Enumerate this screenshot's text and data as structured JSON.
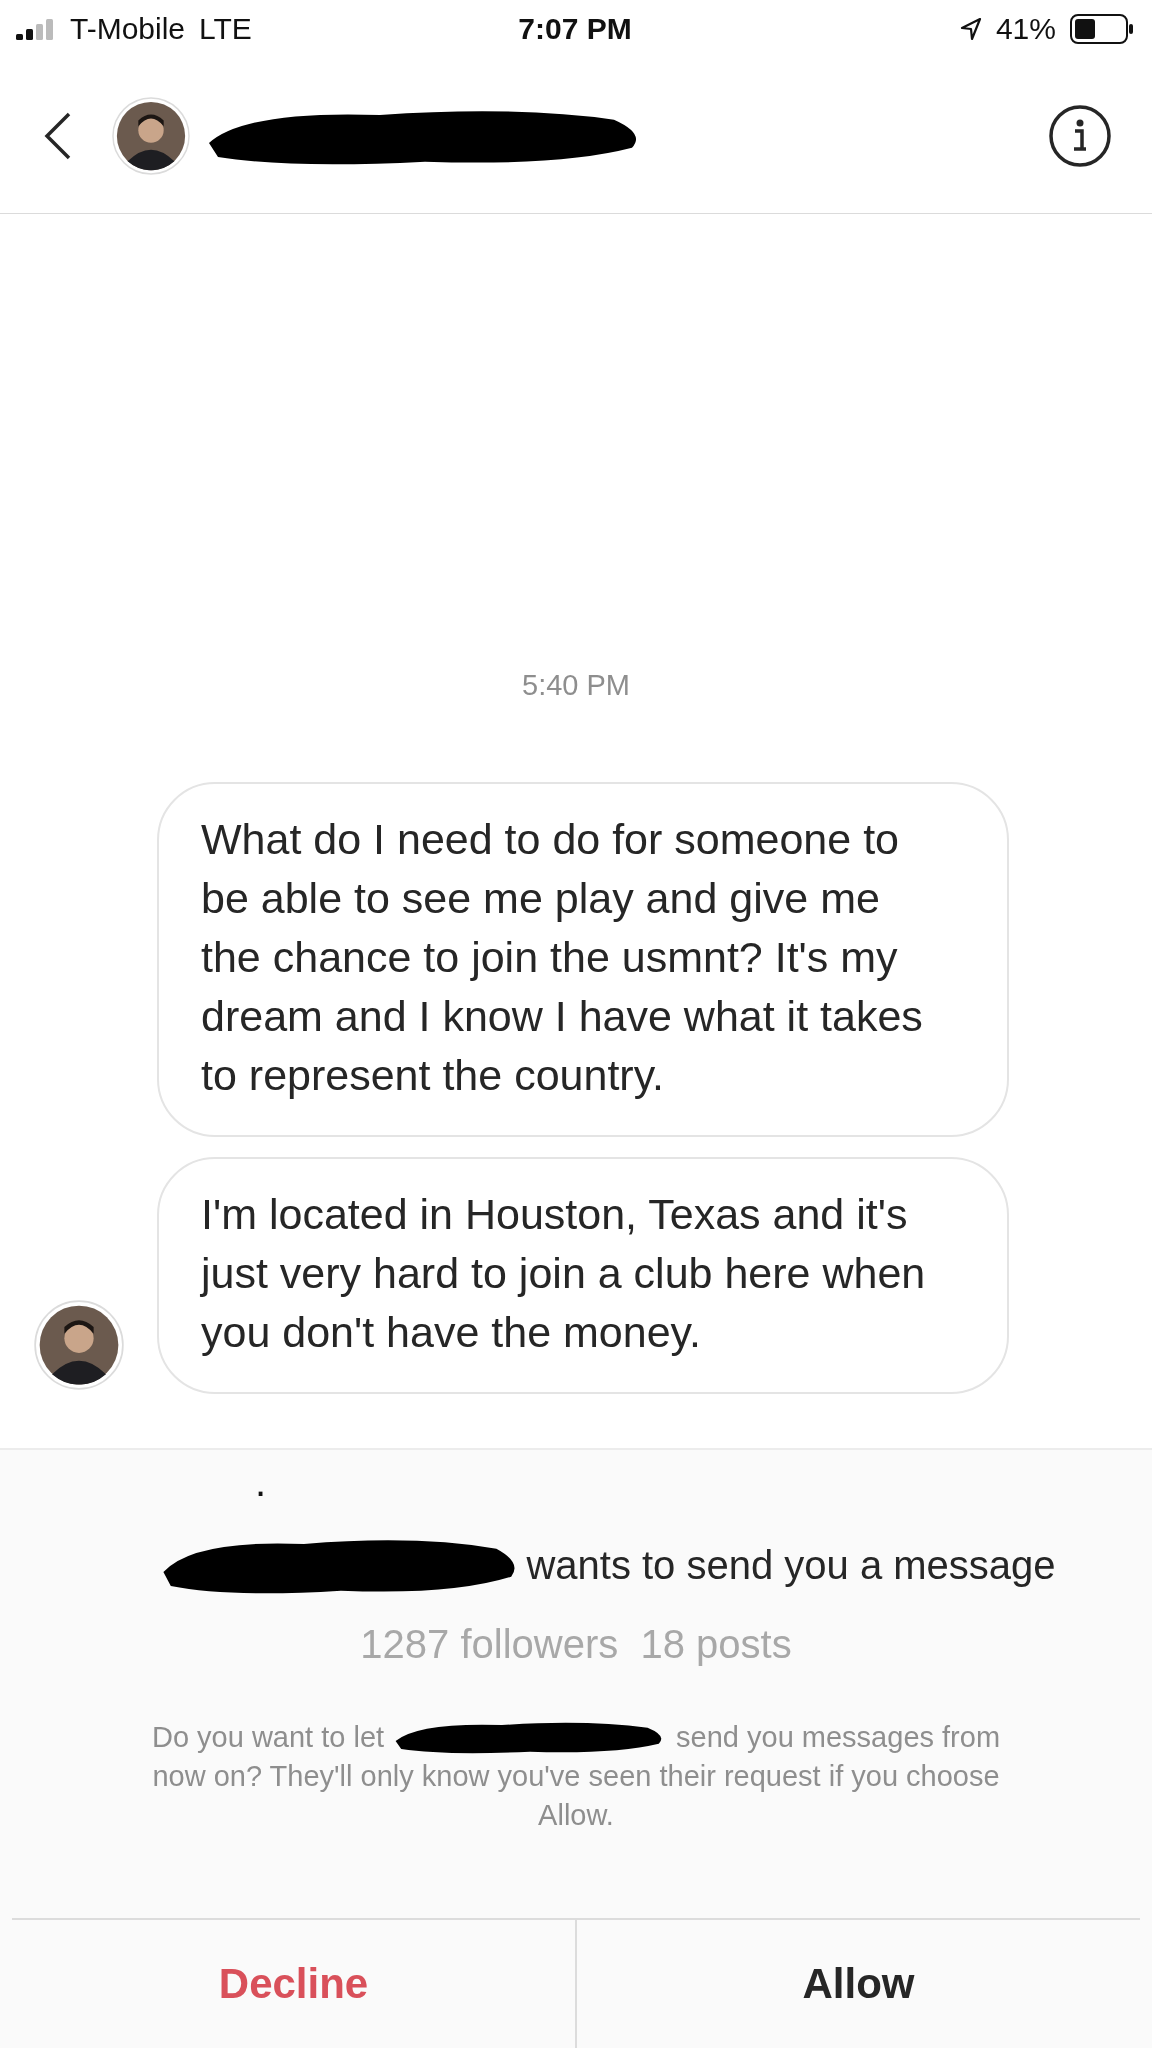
{
  "status_bar": {
    "carrier": "T-Mobile",
    "network": "LTE",
    "time": "7:07 PM",
    "battery_percent": "41%"
  },
  "thread": {
    "timestamp": "5:40 PM",
    "messages": [
      {
        "text": "What do I need to do for someone to be able to see me play and give me the chance to join the usmnt? It's my dream and I know I have what it takes to represent the country.",
        "show_avatar": false
      },
      {
        "text": "I'm located in Houston, Texas and it's just very hard to join a club here when you don't have the money.",
        "show_avatar": true
      }
    ]
  },
  "request": {
    "dot": ".",
    "headline": "wants to send you a message",
    "stats": "1287 followers  18 posts",
    "prompt_start": "Do you want to let",
    "prompt_middle": "send you messages from",
    "prompt_rest": "now on? They'll only know you've seen their request if you choose Allow."
  },
  "actions": [
    {
      "label": "Decline",
      "kind": "destructive"
    },
    {
      "label": "Allow",
      "kind": "primary"
    }
  ]
}
